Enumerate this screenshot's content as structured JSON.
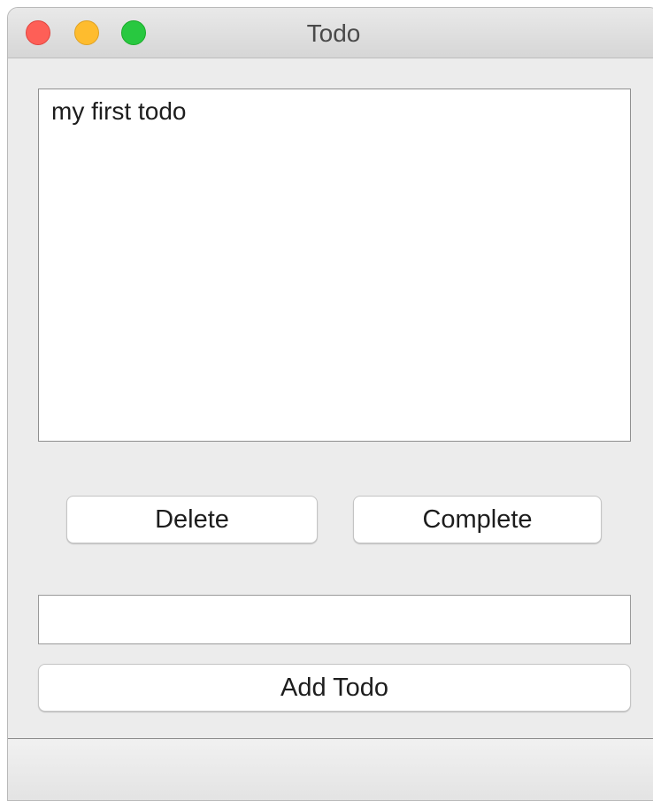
{
  "window": {
    "title": "Todo",
    "traffic_lights": [
      "close",
      "minimize",
      "zoom"
    ],
    "colors": {
      "close": "#fe5f57",
      "minimize": "#febc2e",
      "zoom": "#28c840",
      "background": "#ececec"
    }
  },
  "todo_list": {
    "items": [
      {
        "label": "my first todo"
      }
    ]
  },
  "actions": {
    "delete_label": "Delete",
    "complete_label": "Complete"
  },
  "new_todo": {
    "value": "",
    "placeholder": ""
  },
  "add_button": {
    "label": "Add Todo"
  }
}
